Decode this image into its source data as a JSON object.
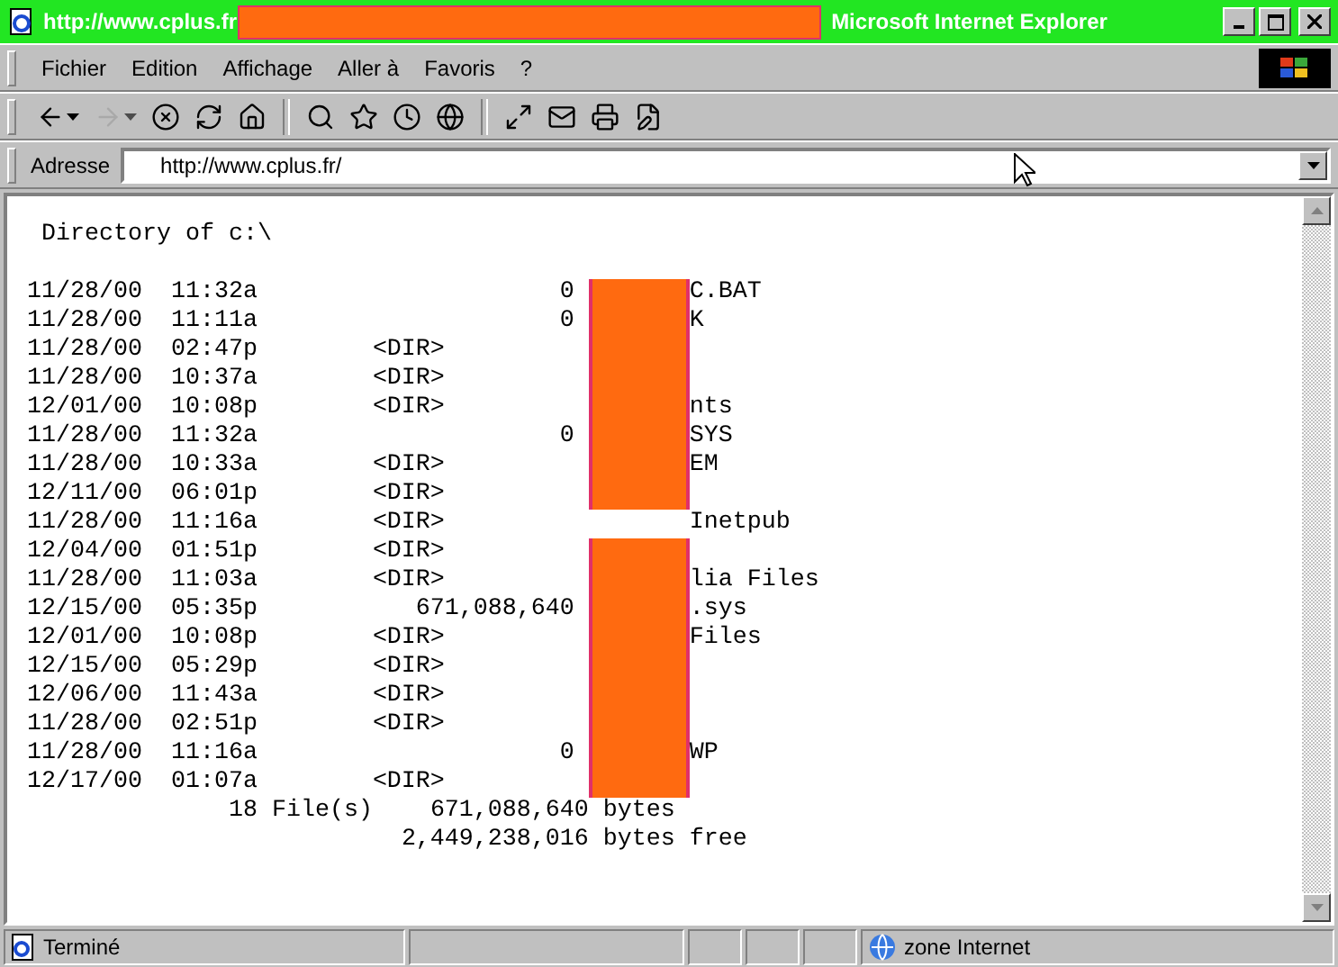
{
  "window": {
    "title_start": "http://www.cplus.fr",
    "title_end": "Microsoft Internet Explorer"
  },
  "menu": [
    "Fichier",
    "Edition",
    "Affichage",
    "Aller à",
    "Favoris",
    "?"
  ],
  "toolbar": [
    {
      "kind": "back",
      "dropdown": true,
      "disabled": false
    },
    {
      "kind": "forward",
      "dropdown": true,
      "disabled": true
    },
    {
      "kind": "stop",
      "dropdown": false,
      "disabled": false
    },
    {
      "kind": "refresh",
      "dropdown": false,
      "disabled": false
    },
    {
      "kind": "home",
      "dropdown": false,
      "disabled": false
    },
    {
      "kind": "sep"
    },
    {
      "kind": "search",
      "dropdown": false,
      "disabled": false
    },
    {
      "kind": "favorites",
      "dropdown": false,
      "disabled": false
    },
    {
      "kind": "history",
      "dropdown": false,
      "disabled": false
    },
    {
      "kind": "channels",
      "dropdown": false,
      "disabled": false
    },
    {
      "kind": "sep"
    },
    {
      "kind": "fullscreen",
      "dropdown": false,
      "disabled": false
    },
    {
      "kind": "mail",
      "dropdown": false,
      "disabled": false
    },
    {
      "kind": "print",
      "dropdown": false,
      "disabled": false
    },
    {
      "kind": "edit",
      "dropdown": false,
      "disabled": false
    }
  ],
  "address": {
    "label": "Adresse",
    "value": "http://www.cplus.fr/"
  },
  "listing": {
    "heading": "Directory of c:\\",
    "rows": [
      {
        "date": "11/28/00",
        "time": "11:32a",
        "size": "0",
        "name": "C.BAT",
        "redacted": true
      },
      {
        "date": "11/28/00",
        "time": "11:11a",
        "size": "0",
        "name": "K",
        "redacted": true
      },
      {
        "date": "11/28/00",
        "time": "02:47p",
        "size": "<DIR>",
        "redacted": true
      },
      {
        "date": "11/28/00",
        "time": "10:37a",
        "size": "<DIR>",
        "redacted": true
      },
      {
        "date": "12/01/00",
        "time": "10:08p",
        "size": "<DIR>",
        "name": "nts",
        "redacted": true
      },
      {
        "date": "11/28/00",
        "time": "11:32a",
        "size": "0",
        "name": "SYS",
        "redacted": true
      },
      {
        "date": "11/28/00",
        "time": "10:33a",
        "size": "<DIR>",
        "name": "EM",
        "redacted": true
      },
      {
        "date": "12/11/00",
        "time": "06:01p",
        "size": "<DIR>",
        "redacted": true
      },
      {
        "date": "11/28/00",
        "time": "11:16a",
        "size": "<DIR>",
        "name": "Inetpub",
        "redacted": false
      },
      {
        "date": "12/04/00",
        "time": "01:51p",
        "size": "<DIR>",
        "redacted": true
      },
      {
        "date": "11/28/00",
        "time": "11:03a",
        "size": "<DIR>",
        "name": "lia Files",
        "redacted": true
      },
      {
        "date": "12/15/00",
        "time": "05:35p",
        "size": "671,088,640",
        "name": ".sys",
        "redacted": true
      },
      {
        "date": "12/01/00",
        "time": "10:08p",
        "size": "<DIR>",
        "name": "Files",
        "redacted": true
      },
      {
        "date": "12/15/00",
        "time": "05:29p",
        "size": "<DIR>",
        "redacted": true
      },
      {
        "date": "12/06/00",
        "time": "11:43a",
        "size": "<DIR>",
        "redacted": true
      },
      {
        "date": "11/28/00",
        "time": "02:51p",
        "size": "<DIR>",
        "redacted": true
      },
      {
        "date": "11/28/00",
        "time": "11:16a",
        "size": "0",
        "name": "WP",
        "redacted": true
      },
      {
        "date": "12/17/00",
        "time": "01:07a",
        "size": "<DIR>",
        "redacted": true
      }
    ],
    "file_count": "18 File(s)",
    "total_bytes": "671,088,640 bytes",
    "free_bytes": "2,449,238,016 bytes free"
  },
  "status_bar": {
    "text": "Terminé",
    "zone": "zone Internet"
  }
}
